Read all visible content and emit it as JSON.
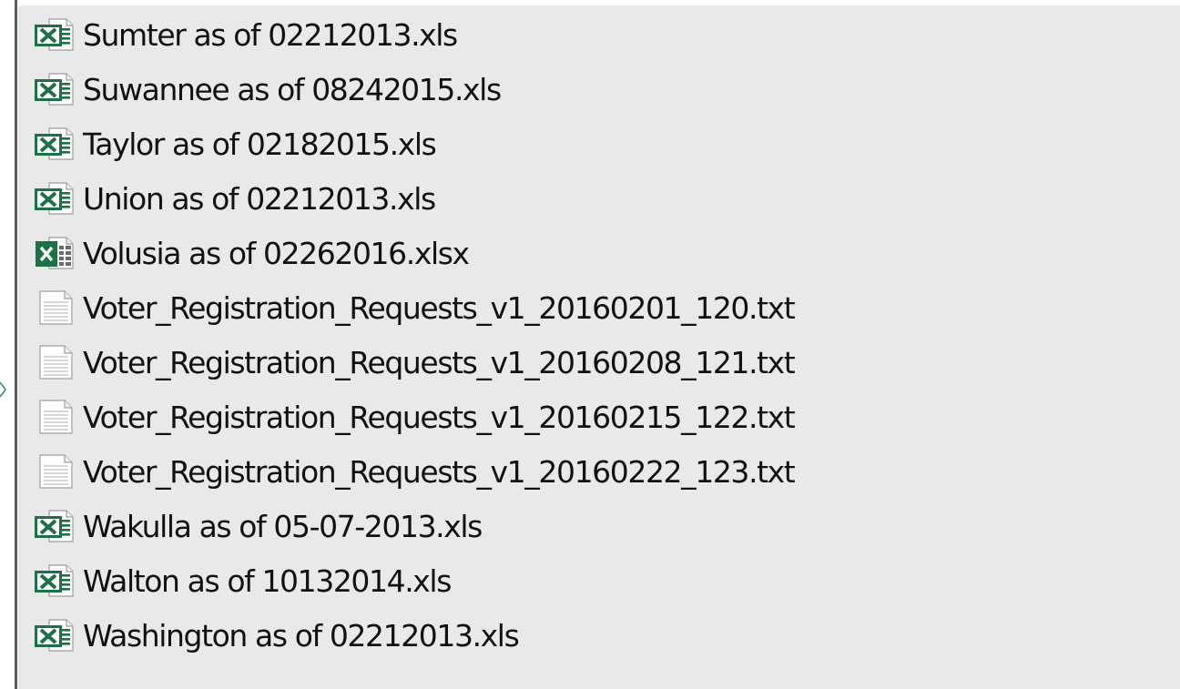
{
  "files": [
    {
      "name": "Sumter as of 02212013.xls",
      "icon": "excel-xls-icon"
    },
    {
      "name": "Suwannee as of 08242015.xls",
      "icon": "excel-xls-icon"
    },
    {
      "name": "Taylor as of 02182015.xls",
      "icon": "excel-xls-icon"
    },
    {
      "name": "Union as of 02212013.xls",
      "icon": "excel-xls-icon"
    },
    {
      "name": "Volusia as of 02262016.xlsx",
      "icon": "excel-xlsx-icon"
    },
    {
      "name": "Voter_Registration_Requests_v1_20160201_120.txt",
      "icon": "text-file-icon"
    },
    {
      "name": "Voter_Registration_Requests_v1_20160208_121.txt",
      "icon": "text-file-icon"
    },
    {
      "name": "Voter_Registration_Requests_v1_20160215_122.txt",
      "icon": "text-file-icon"
    },
    {
      "name": "Voter_Registration_Requests_v1_20160222_123.txt",
      "icon": "text-file-icon"
    },
    {
      "name": "Wakulla as of 05-07-2013.xls",
      "icon": "excel-xls-icon"
    },
    {
      "name": "Walton as of 10132014.xls",
      "icon": "excel-xls-icon"
    },
    {
      "name": "Washington as of 02212013.xls",
      "icon": "excel-xls-icon"
    }
  ],
  "colors": {
    "pane_background": "#e9e9e9",
    "excel_green": "#1e7145",
    "text": "#111111"
  }
}
